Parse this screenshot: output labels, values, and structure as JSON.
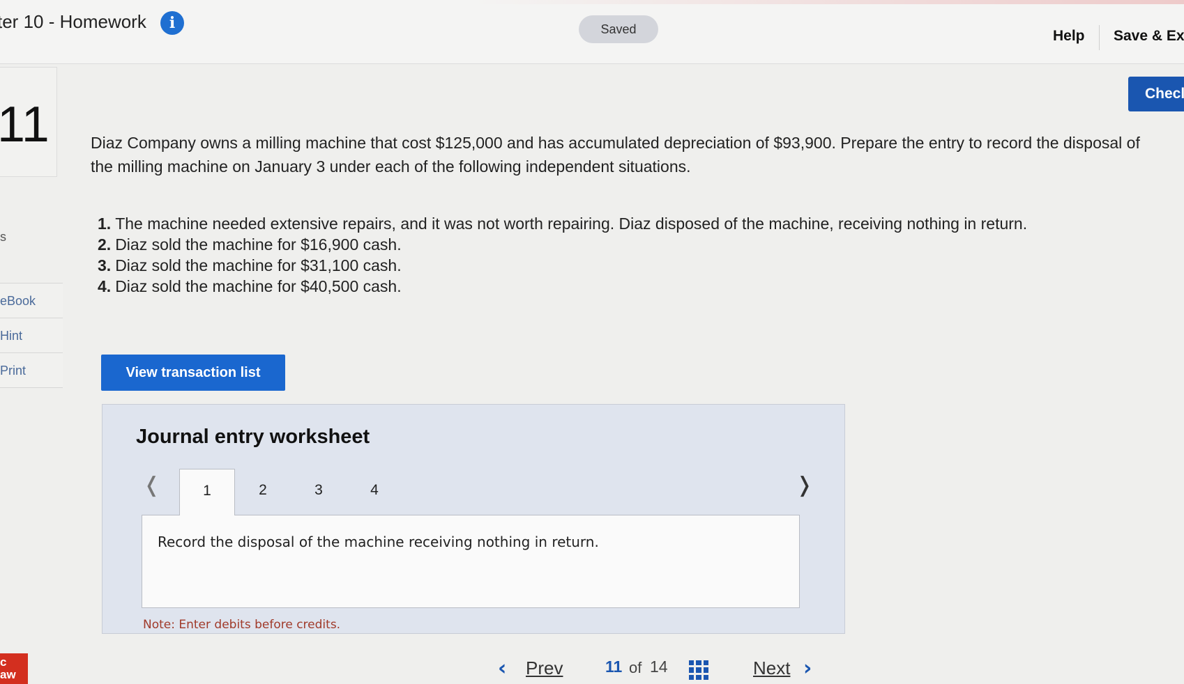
{
  "header": {
    "title": "ter 10 - Homework",
    "info_icon": "info-icon",
    "status": "Saved",
    "help_label": "Help",
    "save_exit_label": "Save & Ex",
    "check_label": "Checl"
  },
  "question": {
    "number": "11",
    "prompt": "Diaz Company owns a milling machine that cost $125,000 and has accumulated depreciation of $93,900. Prepare the entry to record the disposal of the milling machine on January 3 under each of the following independent situations.",
    "tasks": [
      {
        "num": "1.",
        "text": "The machine needed extensive repairs, and it was not worth repairing. Diaz disposed of the machine, receiving nothing in return."
      },
      {
        "num": "2.",
        "text": "Diaz sold the machine for $16,900 cash."
      },
      {
        "num": "3.",
        "text": "Diaz sold the machine for $31,100 cash."
      },
      {
        "num": "4.",
        "text": "Diaz sold the machine for $40,500 cash."
      }
    ]
  },
  "sidebar": {
    "partial_label": "s",
    "tools": [
      "eBook",
      "Hint",
      "Print"
    ]
  },
  "actions": {
    "view_transactions": "View transaction list"
  },
  "worksheet": {
    "title": "Journal entry worksheet",
    "tabs": [
      "1",
      "2",
      "3",
      "4"
    ],
    "active_tab": "1",
    "prev_icon": "chevron-left-icon",
    "next_icon": "chevron-right-icon",
    "instruction": "Record the disposal of the machine receiving nothing in return.",
    "note": "Note: Enter debits before credits."
  },
  "footer": {
    "brand_text": "c\naw",
    "prev_label": "Prev",
    "current_page": "11",
    "of_label": "of",
    "total_pages": "14",
    "grid_icon": "grid-icon",
    "next_label": "Next"
  },
  "colors": {
    "accent_blue": "#1a56b0",
    "button_blue": "#1a67cf",
    "note_red": "#a03a2a",
    "brand_red": "#d32f1f"
  }
}
